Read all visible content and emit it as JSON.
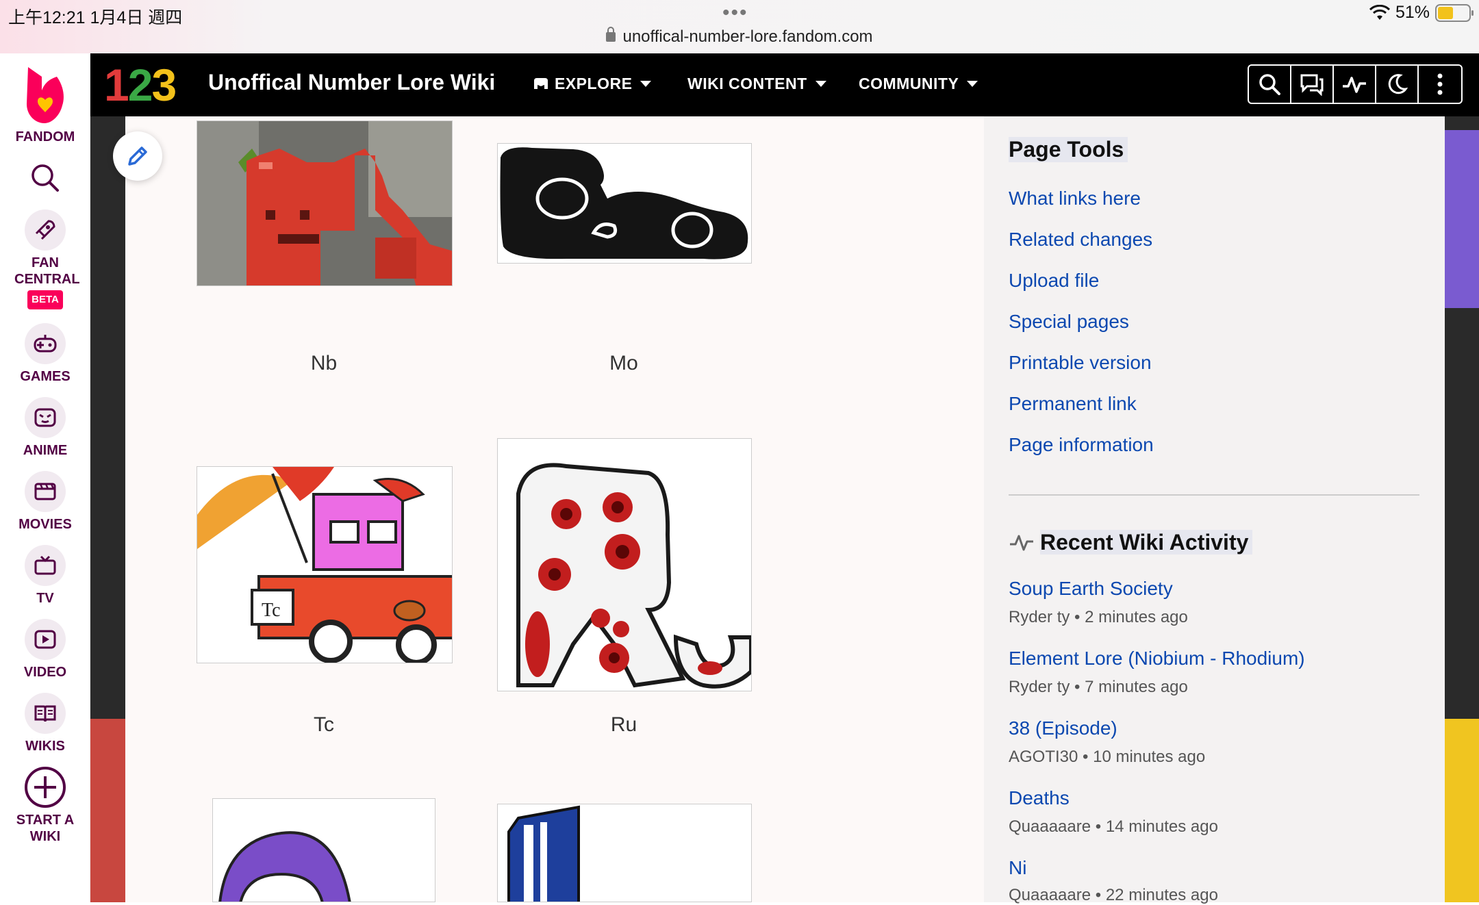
{
  "status_bar": {
    "time": "上午12:21 1月4日 週四",
    "battery": "51%",
    "battery_level": 0.51,
    "url": "unoffical-number-lore.fandom.com"
  },
  "fandom_rail": {
    "brand": "FANDOM",
    "items": [
      {
        "label": "FAN CENTRAL",
        "badge": "BETA",
        "icon": "rocket-icon"
      },
      {
        "label": "GAMES",
        "icon": "controller-icon"
      },
      {
        "label": "ANIME",
        "icon": "anime-face-icon"
      },
      {
        "label": "MOVIES",
        "icon": "clapper-icon"
      },
      {
        "label": "TV",
        "icon": "tv-icon"
      },
      {
        "label": "VIDEO",
        "icon": "play-icon"
      },
      {
        "label": "WIKIS",
        "icon": "book-icon"
      },
      {
        "label": "START A WIKI",
        "icon": "plus-circle-icon"
      }
    ]
  },
  "wiki_nav": {
    "logo": "123",
    "title": "Unoffical Number Lore Wiki",
    "links": [
      "EXPLORE",
      "WIKI CONTENT",
      "COMMUNITY"
    ]
  },
  "gallery": {
    "items": [
      {
        "caption": "Nb"
      },
      {
        "caption": "Mo"
      },
      {
        "caption": "Tc"
      },
      {
        "caption": "Ru"
      }
    ]
  },
  "page_tools": {
    "heading": "Page Tools",
    "links": [
      "What links here",
      "Related changes",
      "Upload file",
      "Special pages",
      "Printable version",
      "Permanent link",
      "Page information"
    ]
  },
  "recent_activity": {
    "heading": "Recent Wiki Activity",
    "entries": [
      {
        "title": "Soup Earth Society",
        "meta": "Ryder ty • 2 minutes ago"
      },
      {
        "title": "Element Lore (Niobium - Rhodium)",
        "meta": "Ryder ty • 7 minutes ago"
      },
      {
        "title": "38 (Episode)",
        "meta": "AGOTI30 • 10 minutes ago"
      },
      {
        "title": "Deaths",
        "meta": "Quaaaaare • 14 minutes ago"
      },
      {
        "title": "Ni",
        "meta": "Quaaaaare • 22 minutes ago"
      }
    ]
  },
  "colors": {
    "link": "#0c48b0",
    "fandom_pink": "#fa005a",
    "rail_text": "#520044"
  }
}
